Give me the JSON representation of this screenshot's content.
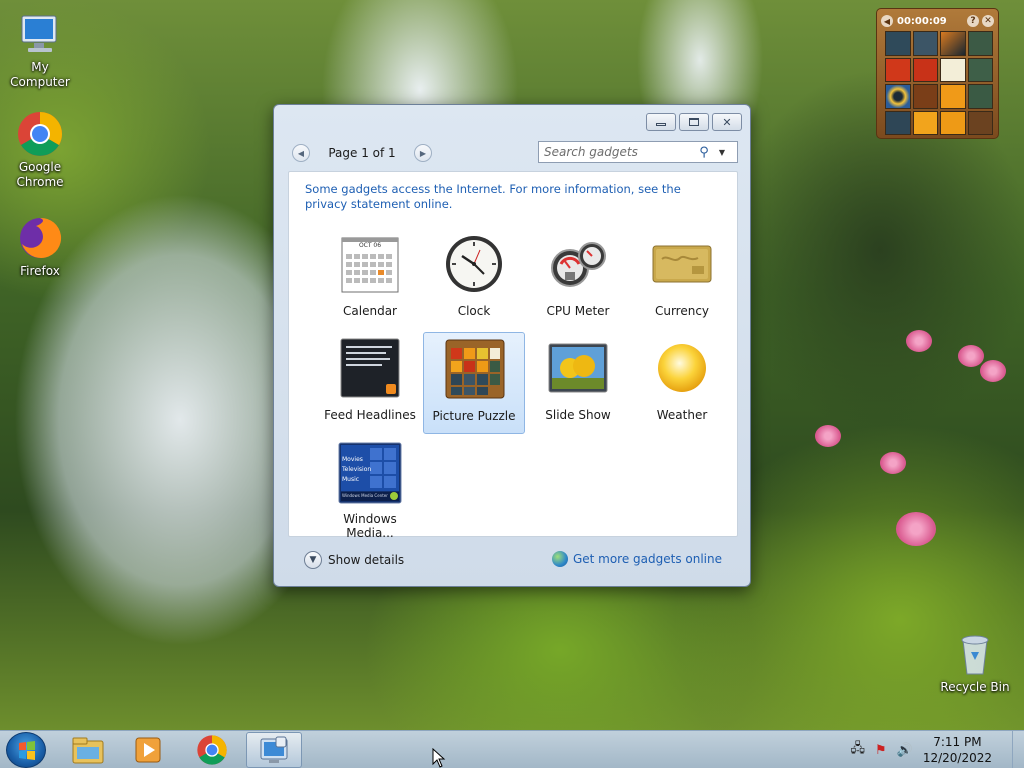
{
  "desktop": {
    "icons": [
      {
        "label": "My Computer",
        "icon": "computer-icon"
      },
      {
        "label": "Google Chrome",
        "icon": "chrome-icon"
      },
      {
        "label": "Firefox",
        "icon": "firefox-icon"
      },
      {
        "label": "Recycle Bin",
        "icon": "recycle-bin-icon"
      }
    ]
  },
  "puzzle_gadget": {
    "timer": "00:00:09",
    "icons": [
      "puzzle-back-icon",
      "help-icon",
      "close-icon"
    ]
  },
  "gallery": {
    "window_buttons": [
      "minimize-icon",
      "restore-icon",
      "close-icon"
    ],
    "pager": {
      "label": "Page 1 of 1"
    },
    "search": {
      "placeholder": "Search gadgets"
    },
    "note": "Some gadgets access the Internet.  For more information, see the privacy statement online.",
    "gadgets": [
      {
        "label": "Calendar",
        "icon": "calendar-icon",
        "selected": false,
        "calendar_month": "OCT 06"
      },
      {
        "label": "Clock",
        "icon": "clock-icon",
        "selected": false
      },
      {
        "label": "CPU Meter",
        "icon": "cpu-meter-icon",
        "selected": false
      },
      {
        "label": "Currency",
        "icon": "currency-icon",
        "selected": false
      },
      {
        "label": "Feed Headlines",
        "icon": "feed-headlines-icon",
        "selected": false
      },
      {
        "label": "Picture Puzzle",
        "icon": "picture-puzzle-icon",
        "selected": true
      },
      {
        "label": "Slide Show",
        "icon": "slide-show-icon",
        "selected": false
      },
      {
        "label": "Weather",
        "icon": "weather-icon",
        "selected": false
      },
      {
        "label": "Windows Media...",
        "icon": "windows-media-center-icon",
        "selected": false,
        "thumb_lines": [
          "Movies",
          "Television",
          "Music"
        ],
        "thumb_footer": "Windows Media Center"
      }
    ],
    "footer": {
      "show_details": "Show details",
      "get_more": "Get more gadgets online"
    }
  },
  "taskbar": {
    "items": [
      {
        "icon": "windows-explorer-icon",
        "active": false
      },
      {
        "icon": "media-player-icon",
        "active": false
      },
      {
        "icon": "chrome-icon",
        "active": false
      },
      {
        "icon": "gadget-gallery-icon",
        "active": true
      }
    ],
    "tray_icons": [
      "network-icon",
      "action-center-icon",
      "volume-icon"
    ],
    "clock": {
      "time": "7:11 PM",
      "date": "12/20/2022"
    }
  }
}
